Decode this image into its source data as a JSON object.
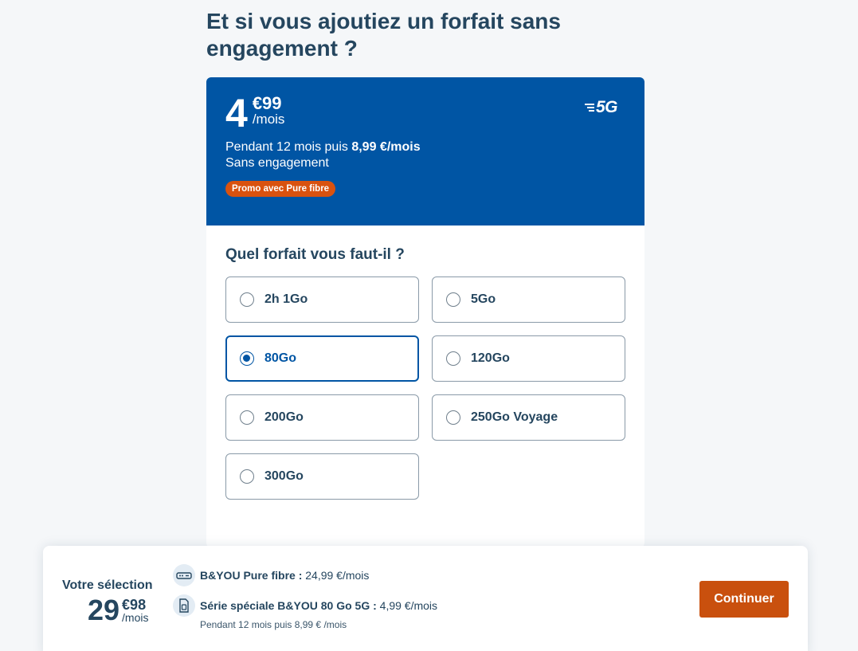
{
  "heading": "Et si vous ajoutiez un forfait sans engagement ?",
  "offer": {
    "price_int": "4",
    "price_cents": "€99",
    "price_unit": "/mois",
    "network_badge": "5G",
    "desc_prefix": "Pendant 12 mois puis ",
    "desc_bold": "8,99 €/mois",
    "desc_line2": "Sans engagement",
    "promo": "Promo avec Pure fibre"
  },
  "question": "Quel forfait vous faut-il ?",
  "options": [
    {
      "label": "2h 1Go",
      "selected": false
    },
    {
      "label": "5Go",
      "selected": false
    },
    {
      "label": "80Go",
      "selected": true
    },
    {
      "label": "120Go",
      "selected": false
    },
    {
      "label": "200Go",
      "selected": false
    },
    {
      "label": "250Go Voyage",
      "selected": false
    },
    {
      "label": "300Go",
      "selected": false
    }
  ],
  "selection": {
    "title": "Votre sélection",
    "price_int": "29",
    "price_cents": "€98",
    "price_unit": "/mois",
    "items": [
      {
        "icon": "router-icon",
        "name": "B&YOU Pure fibre :",
        "price": " 24,99 €/mois"
      },
      {
        "icon": "sim-card-icon",
        "name": "Série spéciale B&YOU 80 Go 5G :",
        "price": " 4,99 €/mois"
      }
    ],
    "note": "Pendant 12 mois puis 8,99 € /mois",
    "continue_label": "Continuer"
  },
  "colors": {
    "brand_blue": "#0055a4",
    "promo_orange": "#d9520f",
    "button_orange": "#c9500e",
    "text_dark": "#25465f"
  }
}
